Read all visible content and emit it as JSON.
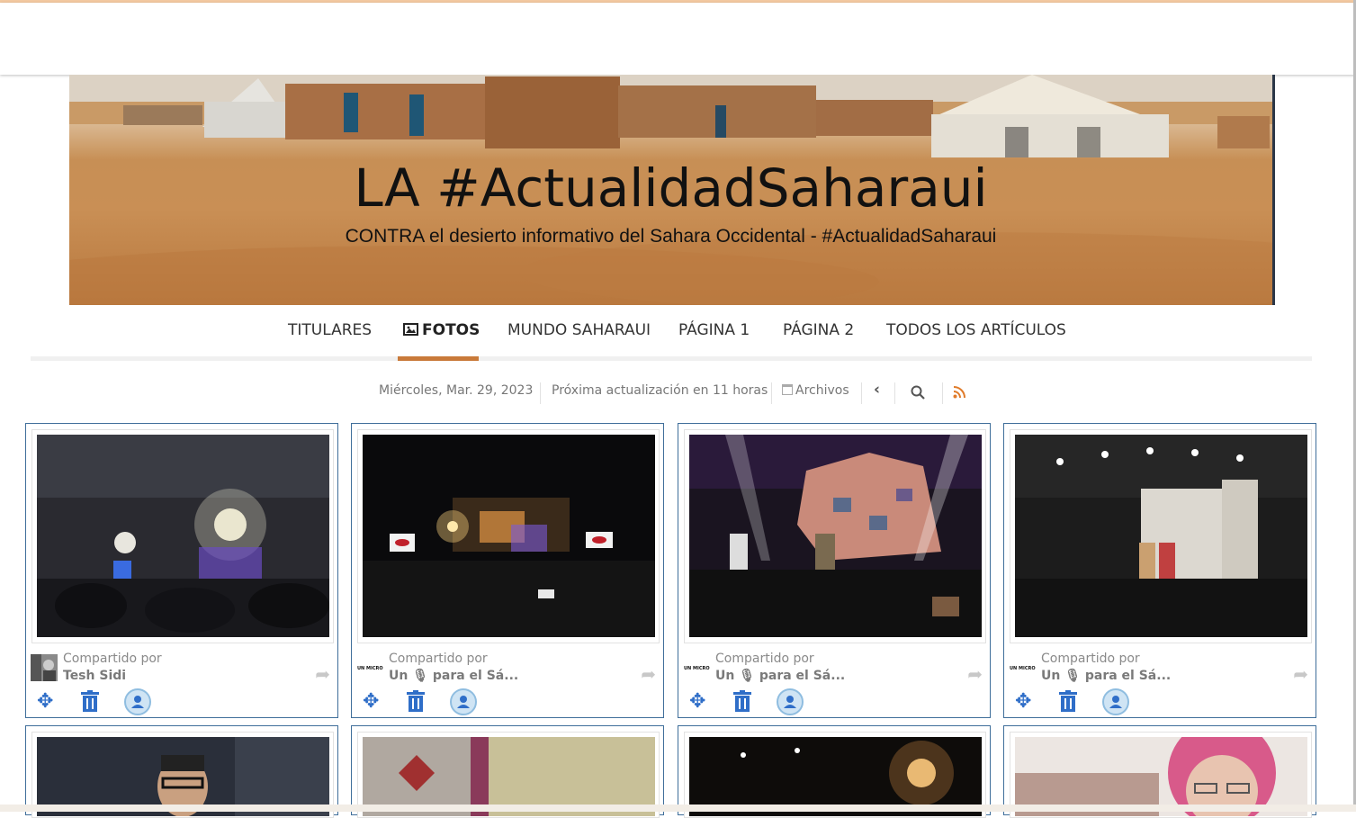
{
  "banner": {
    "title": "LA #ActualidadSaharaui",
    "subtitle": "CONTRA el desierto informativo del Sahara Occidental - #ActualidadSaharaui"
  },
  "nav": {
    "items": [
      {
        "label": "TITULARES"
      },
      {
        "label": "FOTOS",
        "active": true,
        "icon": "image-icon"
      },
      {
        "label": "MUNDO SAHARAUI"
      },
      {
        "label": "PÁGINA 1"
      },
      {
        "label": "PÁGINA 2"
      },
      {
        "label": "TODOS LOS ARTÍCULOS"
      }
    ]
  },
  "infobar": {
    "date": "Miércoles, Mar. 29, 2023",
    "next_update": "Próxima actualización en 11 horas",
    "archives": "Archivos",
    "icons": [
      "calendar-icon",
      "chevron-left-icon",
      "search-icon",
      "rss-icon"
    ]
  },
  "cards": [
    {
      "shared_label": "Compartido por",
      "author": "Tesh Sidi"
    },
    {
      "shared_label": "Compartido por",
      "author": "Un 🎙 para el Sá..."
    },
    {
      "shared_label": "Compartido por",
      "author": "Un 🎙 para el Sá..."
    },
    {
      "shared_label": "Compartido por",
      "author": "Un 🎙 para el Sá..."
    }
  ],
  "avatar_text": "UN MICRO",
  "colors": {
    "accent": "#c97a3a",
    "card_border": "#3f6e9a",
    "action_blue": "#2f6ec8",
    "rss": "#e07b2a"
  }
}
